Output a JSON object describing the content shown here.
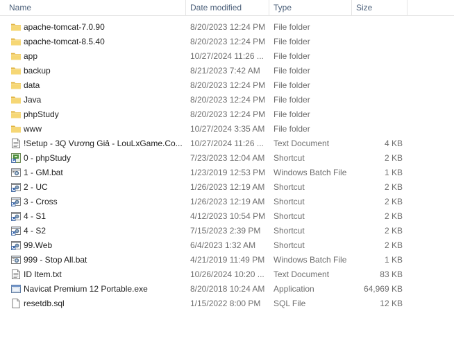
{
  "columns": {
    "name": "Name",
    "date": "Date modified",
    "type": "Type",
    "size": "Size"
  },
  "rows": [
    {
      "name": "apache-tomcat-7.0.90",
      "date": "8/20/2023 12:24 PM",
      "type": "File folder",
      "size": "",
      "icon": "folder-icon"
    },
    {
      "name": "apache-tomcat-8.5.40",
      "date": "8/20/2023 12:24 PM",
      "type": "File folder",
      "size": "",
      "icon": "folder-icon"
    },
    {
      "name": "app",
      "date": "10/27/2024 11:26 ...",
      "type": "File folder",
      "size": "",
      "icon": "folder-icon"
    },
    {
      "name": "backup",
      "date": "8/21/2023 7:42 AM",
      "type": "File folder",
      "size": "",
      "icon": "folder-icon"
    },
    {
      "name": "data",
      "date": "8/20/2023 12:24 PM",
      "type": "File folder",
      "size": "",
      "icon": "folder-icon"
    },
    {
      "name": "Java",
      "date": "8/20/2023 12:24 PM",
      "type": "File folder",
      "size": "",
      "icon": "folder-icon"
    },
    {
      "name": "phpStudy",
      "date": "8/20/2023 12:24 PM",
      "type": "File folder",
      "size": "",
      "icon": "folder-icon"
    },
    {
      "name": "www",
      "date": "10/27/2024 3:35 AM",
      "type": "File folder",
      "size": "",
      "icon": "folder-icon"
    },
    {
      "name": "!Setup - 3Q Vương Giả - LouLxGame.Co...",
      "date": "10/27/2024 11:26 ...",
      "type": "Text Document",
      "size": "4 KB",
      "icon": "text-document-icon"
    },
    {
      "name": "0 - phpStudy",
      "date": "7/23/2023 12:04 AM",
      "type": "Shortcut",
      "size": "2 KB",
      "icon": "app-shortcut-icon"
    },
    {
      "name": "1 - GM.bat",
      "date": "1/23/2019 12:53 PM",
      "type": "Windows Batch File",
      "size": "1 KB",
      "icon": "batch-file-icon"
    },
    {
      "name": "2 - UC",
      "date": "1/26/2023 12:19 AM",
      "type": "Shortcut",
      "size": "2 KB",
      "icon": "shortcut-icon"
    },
    {
      "name": "3 - Cross",
      "date": "1/26/2023 12:19 AM",
      "type": "Shortcut",
      "size": "2 KB",
      "icon": "shortcut-icon"
    },
    {
      "name": "4 - S1",
      "date": "4/12/2023 10:54 PM",
      "type": "Shortcut",
      "size": "2 KB",
      "icon": "shortcut-icon"
    },
    {
      "name": "4 - S2",
      "date": "7/15/2023 2:39 PM",
      "type": "Shortcut",
      "size": "2 KB",
      "icon": "shortcut-icon"
    },
    {
      "name": "99.Web",
      "date": "6/4/2023 1:32 AM",
      "type": "Shortcut",
      "size": "2 KB",
      "icon": "shortcut-icon"
    },
    {
      "name": "999 - Stop All.bat",
      "date": "4/21/2019 11:49 PM",
      "type": "Windows Batch File",
      "size": "1 KB",
      "icon": "batch-file-icon"
    },
    {
      "name": "ID Item.txt",
      "date": "10/26/2024 10:20 ...",
      "type": "Text Document",
      "size": "83 KB",
      "icon": "text-document-icon"
    },
    {
      "name": "Navicat Premium 12 Portable.exe",
      "date": "8/20/2018 10:24 AM",
      "type": "Application",
      "size": "64,969 KB",
      "icon": "application-icon"
    },
    {
      "name": "resetdb.sql",
      "date": "1/15/2022 8:00 PM",
      "type": "SQL File",
      "size": "12 KB",
      "icon": "blank-file-icon"
    }
  ],
  "colors": {
    "folder": "#f4d16a",
    "folder_dark": "#e0b23c",
    "header_text": "#4c607a",
    "detail_text": "#6d6d6d"
  }
}
